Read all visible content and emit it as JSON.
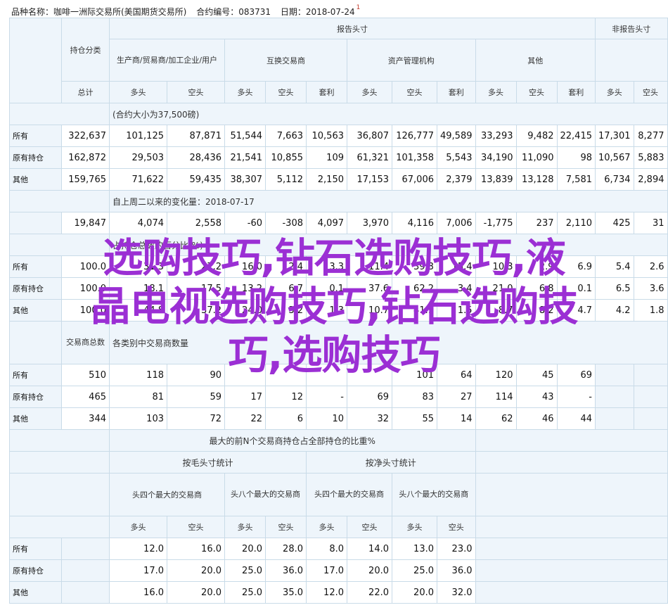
{
  "header": {
    "exchange": "品种名称：咖啡一洲际交易所(美国期货交易所)",
    "contract_code": "合约编号：083731",
    "date": "日期：2018-07-24",
    "marker": "1"
  },
  "table1": {
    "report_label": "报告头寸",
    "non_report_label": "非报告头寸",
    "position_class": "持仓分类",
    "producer": "生产商/贸易商/加工企业/用户",
    "swap": "互换交易商",
    "managed": "资产管理机构",
    "other": "其他",
    "total": "总计",
    "long": "多头",
    "short": "空头",
    "spread": "套利",
    "note_contract": "(合约大小为37,500磅)",
    "note_change": "自上周二以来的变化量：2018-07-17",
    "note_pct": "占持仓总数的百分比(%)",
    "traders": "交易商总数",
    "note_traders": "各类别中交易商数量",
    "rows": [
      {
        "label": "所有",
        "v": [
          "322,637",
          "101,125",
          "87,871",
          "51,544",
          "7,663",
          "10,563",
          "36,807",
          "126,777",
          "49,589",
          "33,293",
          "9,482",
          "22,415",
          "17,301",
          "8,277"
        ]
      },
      {
        "label": "原有持仓",
        "v": [
          "162,872",
          "29,503",
          "28,436",
          "21,541",
          "10,855",
          "109",
          "61,321",
          "101,358",
          "5,543",
          "34,190",
          "11,090",
          "98",
          "10,567",
          "5,883"
        ]
      },
      {
        "label": "其他",
        "v": [
          "159,765",
          "71,622",
          "59,435",
          "38,307",
          "5,112",
          "2,150",
          "17,153",
          "67,006",
          "2,379",
          "13,839",
          "13,128",
          "7,581",
          "6,734",
          "2,894"
        ]
      }
    ],
    "change": [
      "19,847",
      "4,074",
      "2,558",
      "-60",
      "-308",
      "4,097",
      "3,970",
      "4,116",
      "7,006",
      "-1,775",
      "237",
      "2,110",
      "425",
      "31"
    ],
    "pct_rows": [
      {
        "label": "所有",
        "v": [
          "100.0",
          "31.3",
          "27.2",
          "16.0",
          "2.4",
          "3.3",
          "11.4",
          "39.3",
          "15.4",
          "10.3",
          "2.9",
          "6.9",
          "5.4",
          "2.6"
        ]
      },
      {
        "label": "原有持仓",
        "v": [
          "100.0",
          "18.1",
          "17.5",
          "13.2",
          "6.7",
          "0.1",
          "37.6",
          "62.2",
          "3.4",
          "21.0",
          "6.8",
          "0.1",
          "6.5",
          "3.6"
        ]
      },
      {
        "label": "其他",
        "v": [
          "100.0",
          "44.8",
          "37.2",
          "24.0",
          "3.2",
          "1.3",
          "10.7",
          "41.9",
          "1.5",
          "8.7",
          "8.2",
          "4.7",
          "4.2",
          "1.8"
        ]
      }
    ],
    "trader_rows": [
      {
        "label": "所有",
        "v": [
          "510",
          "118",
          "90",
          "",
          "",
          "",
          "",
          "101",
          "64",
          "120",
          "45",
          "69",
          "",
          ""
        ]
      },
      {
        "label": "原有持仓",
        "v": [
          "465",
          "81",
          "59",
          "17",
          "12",
          "-",
          "69",
          "83",
          "27",
          "114",
          "43",
          "-",
          "",
          ""
        ]
      },
      {
        "label": "其他",
        "v": [
          "344",
          "103",
          "72",
          "22",
          "6",
          "10",
          "32",
          "55",
          "14",
          "62",
          "46",
          "44",
          "",
          ""
        ]
      }
    ]
  },
  "table2": {
    "title": "最大的前N个交易商持仓占全部持仓的比重%",
    "gross": "按毛头寸统计",
    "net": "按净头寸统计",
    "top4": "头四个最大的交易商",
    "top8": "头八个最大的交易商",
    "long": "多头",
    "short": "空头",
    "rows": [
      {
        "label": "所有",
        "v": [
          "12.0",
          "16.0",
          "20.0",
          "28.0",
          "8.0",
          "14.0",
          "13.0",
          "23.0"
        ]
      },
      {
        "label": "原有持仓",
        "v": [
          "17.0",
          "20.0",
          "25.0",
          "36.0",
          "17.0",
          "20.0",
          "25.0",
          "36.0"
        ]
      },
      {
        "label": "其他",
        "v": [
          "16.0",
          "20.0",
          "25.0",
          "35.0",
          "12.0",
          "22.0",
          "20.0",
          "32.0"
        ]
      }
    ]
  },
  "overlay": {
    "line1": "选购技巧,钻石选购技巧,液",
    "line2": "晶电视选购技巧,钻石选购技",
    "line3": "巧,选购技巧"
  },
  "colors": {
    "overlay": "#9b2fd4",
    "header_bg": "#eef5fb",
    "border": "#c9dbe8"
  }
}
